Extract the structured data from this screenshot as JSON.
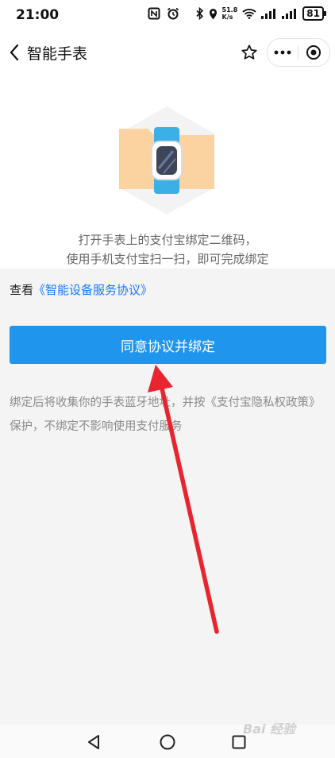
{
  "status_bar": {
    "time": "21:00",
    "net_speed_value": "51.8",
    "net_speed_unit": "K/s",
    "battery": "81"
  },
  "nav": {
    "title": "智能手表"
  },
  "hero": {
    "line1": "打开手表上的支付宝绑定二维码，",
    "line2": "使用手机支付宝扫一扫，即可完成绑定"
  },
  "agreement": {
    "prefix": "查看",
    "link": "《智能设备服务协议》"
  },
  "bind_button": {
    "label": "同意协议并绑定"
  },
  "notice": {
    "text": "绑定后将收集你的手表蓝牙地址，并按《支付宝隐私权政策》保护，不绑定不影响使用支付服务"
  },
  "watermark": {
    "text": "Bai 经验"
  },
  "colors": {
    "primary_button": "#1f95ee",
    "link": "#1677ff",
    "annotation_arrow": "#e8252e"
  }
}
